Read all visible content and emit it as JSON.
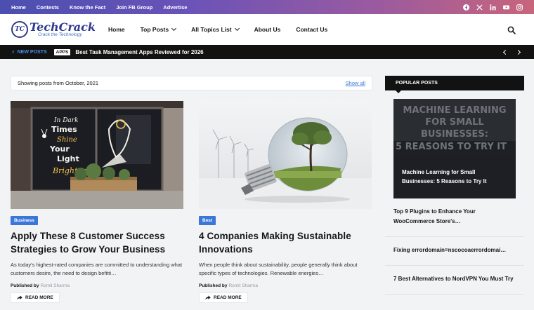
{
  "topbar": {
    "links": [
      "Home",
      "Contests",
      "Know the Fact",
      "Join FB Group",
      "Advertise"
    ],
    "socials": [
      "facebook-icon",
      "x-icon",
      "linkedin-icon",
      "youtube-icon",
      "instagram-icon"
    ],
    "gradient": [
      "#4b4fb0",
      "#c8657c"
    ]
  },
  "header": {
    "logo_title": "TechCrack",
    "logo_tagline": "Crack the Technology",
    "logo_mark": "TC",
    "nav": [
      {
        "label": "Home",
        "dropdown": false
      },
      {
        "label": "Top Posts",
        "dropdown": true
      },
      {
        "label": "All Topics List",
        "dropdown": true
      },
      {
        "label": "About Us",
        "dropdown": false
      },
      {
        "label": "Contact Us",
        "dropdown": false
      }
    ],
    "search_icon": "search-icon"
  },
  "ticker": {
    "label": "NEW POSTS",
    "badge": "APPS",
    "headline": "Best Task Management Apps Reviewed for 2026"
  },
  "archive": {
    "showing_text": "Showing posts from October, 2021",
    "show_all": "Show all"
  },
  "posts": [
    {
      "category": "Business",
      "title": "Apply These 8 Customer Success Strategies to Grow Your Business",
      "excerpt": "As today's highest-rated companies are committed to understanding what customers desire, the need to design befitti…",
      "published_by_label": "Published by",
      "author": "Romit Sharma",
      "read_more": "READ MORE",
      "image_text": [
        "In Dark",
        "Times",
        "Shine",
        "Your",
        "Light",
        "Brighter"
      ]
    },
    {
      "category": "Best",
      "title": "4 Companies Making Sustainable Innovations",
      "excerpt": "When people think about sustainability, people generally think about specific types of technologies. Renewable energies…",
      "published_by_label": "Published by",
      "author": "Romit Sharma",
      "read_more": "READ MORE"
    }
  ],
  "sidebar": {
    "heading": "POPULAR POSTS",
    "feature": {
      "image_lines": [
        "MACHINE LEARNING",
        "FOR SMALL",
        "BUSINESSES:",
        "5 REASONS TO TRY IT"
      ],
      "title": "Machine Learning for Small Businesses: 5 Reasons to Try It"
    },
    "items": [
      "Top 9 Plugins to Enhance Your WooCommerce Store's…",
      "Fixing errordomain=nscocoaerrordomai…",
      "7 Best Alternatives to NordVPN You Must Try"
    ]
  },
  "colors": {
    "accent": "#3a77d8",
    "dark": "#121212",
    "ticker_label": "#4a90e8"
  }
}
